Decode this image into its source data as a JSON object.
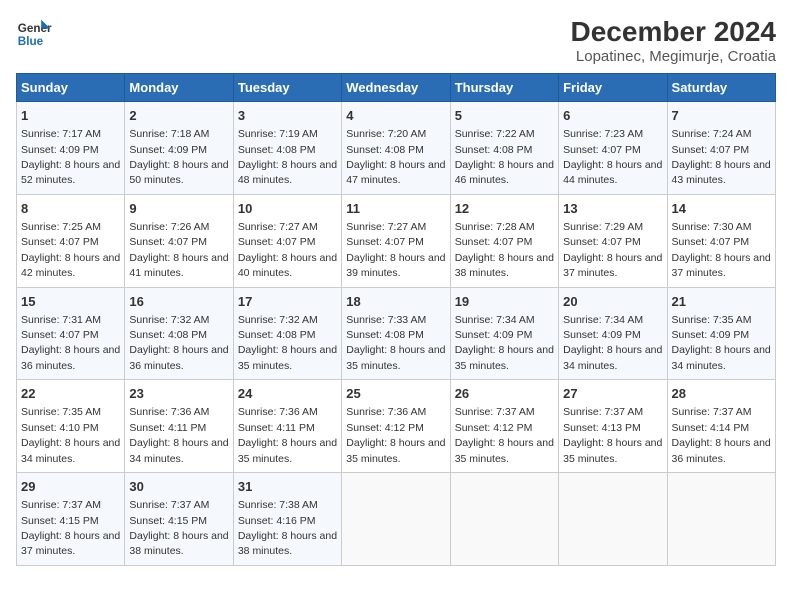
{
  "header": {
    "logo_line1": "General",
    "logo_line2": "Blue",
    "title": "December 2024",
    "subtitle": "Lopatinec, Megimurje, Croatia"
  },
  "weekdays": [
    "Sunday",
    "Monday",
    "Tuesday",
    "Wednesday",
    "Thursday",
    "Friday",
    "Saturday"
  ],
  "weeks": [
    [
      {
        "day": "1",
        "sunrise": "Sunrise: 7:17 AM",
        "sunset": "Sunset: 4:09 PM",
        "daylight": "Daylight: 8 hours and 52 minutes."
      },
      {
        "day": "2",
        "sunrise": "Sunrise: 7:18 AM",
        "sunset": "Sunset: 4:09 PM",
        "daylight": "Daylight: 8 hours and 50 minutes."
      },
      {
        "day": "3",
        "sunrise": "Sunrise: 7:19 AM",
        "sunset": "Sunset: 4:08 PM",
        "daylight": "Daylight: 8 hours and 48 minutes."
      },
      {
        "day": "4",
        "sunrise": "Sunrise: 7:20 AM",
        "sunset": "Sunset: 4:08 PM",
        "daylight": "Daylight: 8 hours and 47 minutes."
      },
      {
        "day": "5",
        "sunrise": "Sunrise: 7:22 AM",
        "sunset": "Sunset: 4:08 PM",
        "daylight": "Daylight: 8 hours and 46 minutes."
      },
      {
        "day": "6",
        "sunrise": "Sunrise: 7:23 AM",
        "sunset": "Sunset: 4:07 PM",
        "daylight": "Daylight: 8 hours and 44 minutes."
      },
      {
        "day": "7",
        "sunrise": "Sunrise: 7:24 AM",
        "sunset": "Sunset: 4:07 PM",
        "daylight": "Daylight: 8 hours and 43 minutes."
      }
    ],
    [
      {
        "day": "8",
        "sunrise": "Sunrise: 7:25 AM",
        "sunset": "Sunset: 4:07 PM",
        "daylight": "Daylight: 8 hours and 42 minutes."
      },
      {
        "day": "9",
        "sunrise": "Sunrise: 7:26 AM",
        "sunset": "Sunset: 4:07 PM",
        "daylight": "Daylight: 8 hours and 41 minutes."
      },
      {
        "day": "10",
        "sunrise": "Sunrise: 7:27 AM",
        "sunset": "Sunset: 4:07 PM",
        "daylight": "Daylight: 8 hours and 40 minutes."
      },
      {
        "day": "11",
        "sunrise": "Sunrise: 7:27 AM",
        "sunset": "Sunset: 4:07 PM",
        "daylight": "Daylight: 8 hours and 39 minutes."
      },
      {
        "day": "12",
        "sunrise": "Sunrise: 7:28 AM",
        "sunset": "Sunset: 4:07 PM",
        "daylight": "Daylight: 8 hours and 38 minutes."
      },
      {
        "day": "13",
        "sunrise": "Sunrise: 7:29 AM",
        "sunset": "Sunset: 4:07 PM",
        "daylight": "Daylight: 8 hours and 37 minutes."
      },
      {
        "day": "14",
        "sunrise": "Sunrise: 7:30 AM",
        "sunset": "Sunset: 4:07 PM",
        "daylight": "Daylight: 8 hours and 37 minutes."
      }
    ],
    [
      {
        "day": "15",
        "sunrise": "Sunrise: 7:31 AM",
        "sunset": "Sunset: 4:07 PM",
        "daylight": "Daylight: 8 hours and 36 minutes."
      },
      {
        "day": "16",
        "sunrise": "Sunrise: 7:32 AM",
        "sunset": "Sunset: 4:08 PM",
        "daylight": "Daylight: 8 hours and 36 minutes."
      },
      {
        "day": "17",
        "sunrise": "Sunrise: 7:32 AM",
        "sunset": "Sunset: 4:08 PM",
        "daylight": "Daylight: 8 hours and 35 minutes."
      },
      {
        "day": "18",
        "sunrise": "Sunrise: 7:33 AM",
        "sunset": "Sunset: 4:08 PM",
        "daylight": "Daylight: 8 hours and 35 minutes."
      },
      {
        "day": "19",
        "sunrise": "Sunrise: 7:34 AM",
        "sunset": "Sunset: 4:09 PM",
        "daylight": "Daylight: 8 hours and 35 minutes."
      },
      {
        "day": "20",
        "sunrise": "Sunrise: 7:34 AM",
        "sunset": "Sunset: 4:09 PM",
        "daylight": "Daylight: 8 hours and 34 minutes."
      },
      {
        "day": "21",
        "sunrise": "Sunrise: 7:35 AM",
        "sunset": "Sunset: 4:09 PM",
        "daylight": "Daylight: 8 hours and 34 minutes."
      }
    ],
    [
      {
        "day": "22",
        "sunrise": "Sunrise: 7:35 AM",
        "sunset": "Sunset: 4:10 PM",
        "daylight": "Daylight: 8 hours and 34 minutes."
      },
      {
        "day": "23",
        "sunrise": "Sunrise: 7:36 AM",
        "sunset": "Sunset: 4:11 PM",
        "daylight": "Daylight: 8 hours and 34 minutes."
      },
      {
        "day": "24",
        "sunrise": "Sunrise: 7:36 AM",
        "sunset": "Sunset: 4:11 PM",
        "daylight": "Daylight: 8 hours and 35 minutes."
      },
      {
        "day": "25",
        "sunrise": "Sunrise: 7:36 AM",
        "sunset": "Sunset: 4:12 PM",
        "daylight": "Daylight: 8 hours and 35 minutes."
      },
      {
        "day": "26",
        "sunrise": "Sunrise: 7:37 AM",
        "sunset": "Sunset: 4:12 PM",
        "daylight": "Daylight: 8 hours and 35 minutes."
      },
      {
        "day": "27",
        "sunrise": "Sunrise: 7:37 AM",
        "sunset": "Sunset: 4:13 PM",
        "daylight": "Daylight: 8 hours and 35 minutes."
      },
      {
        "day": "28",
        "sunrise": "Sunrise: 7:37 AM",
        "sunset": "Sunset: 4:14 PM",
        "daylight": "Daylight: 8 hours and 36 minutes."
      }
    ],
    [
      {
        "day": "29",
        "sunrise": "Sunrise: 7:37 AM",
        "sunset": "Sunset: 4:15 PM",
        "daylight": "Daylight: 8 hours and 37 minutes."
      },
      {
        "day": "30",
        "sunrise": "Sunrise: 7:37 AM",
        "sunset": "Sunset: 4:15 PM",
        "daylight": "Daylight: 8 hours and 38 minutes."
      },
      {
        "day": "31",
        "sunrise": "Sunrise: 7:38 AM",
        "sunset": "Sunset: 4:16 PM",
        "daylight": "Daylight: 8 hours and 38 minutes."
      },
      null,
      null,
      null,
      null
    ]
  ]
}
